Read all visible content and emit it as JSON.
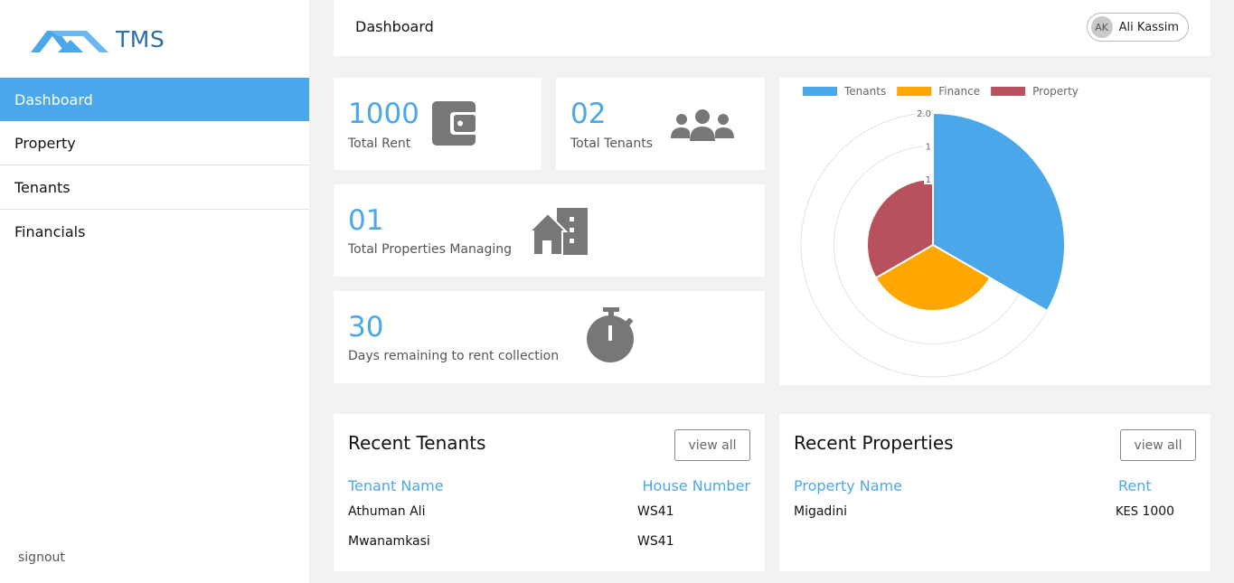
{
  "brand": {
    "name": "TMS"
  },
  "sidebar": {
    "items": [
      {
        "label": "Dashboard"
      },
      {
        "label": "Property"
      },
      {
        "label": "Tenants"
      },
      {
        "label": "Financials"
      }
    ],
    "signout": "signout"
  },
  "header": {
    "title": "Dashboard",
    "user": {
      "initials": "AK",
      "name": "Ali Kassim"
    }
  },
  "stats": {
    "rent": {
      "value": "1000",
      "label": "Total Rent",
      "icon": "wallet-icon"
    },
    "tenants": {
      "value": "02",
      "label": "Total Tenants",
      "icon": "users-group-icon"
    },
    "properties": {
      "value": "01",
      "label": "Total Properties Managing",
      "icon": "building-icon"
    },
    "days": {
      "value": "30",
      "label": "Days remaining to rent collection",
      "icon": "stopwatch-icon"
    }
  },
  "chart_data": {
    "type": "polar-area",
    "categories": [
      "Tenants",
      "Finance",
      "Property"
    ],
    "values": [
      2,
      1,
      1
    ],
    "colors": [
      "#4aa8ea",
      "#ffa600",
      "#b6515d"
    ],
    "scale_ticks": [
      "2.0",
      "1",
      "1"
    ],
    "legend": "top"
  },
  "recent_tenants": {
    "title": "Recent Tenants",
    "view_all": "view all",
    "columns": [
      "Tenant Name",
      "House Number"
    ],
    "rows": [
      [
        "Athuman Ali",
        "WS41"
      ],
      [
        "Mwanamkasi",
        "WS41"
      ]
    ]
  },
  "recent_properties": {
    "title": "Recent Properties",
    "view_all": "view all",
    "columns": [
      "Property Name",
      "Rent"
    ],
    "rows": [
      {
        "name": "Migadini",
        "currency": "KES",
        "amount": "1000"
      }
    ]
  }
}
